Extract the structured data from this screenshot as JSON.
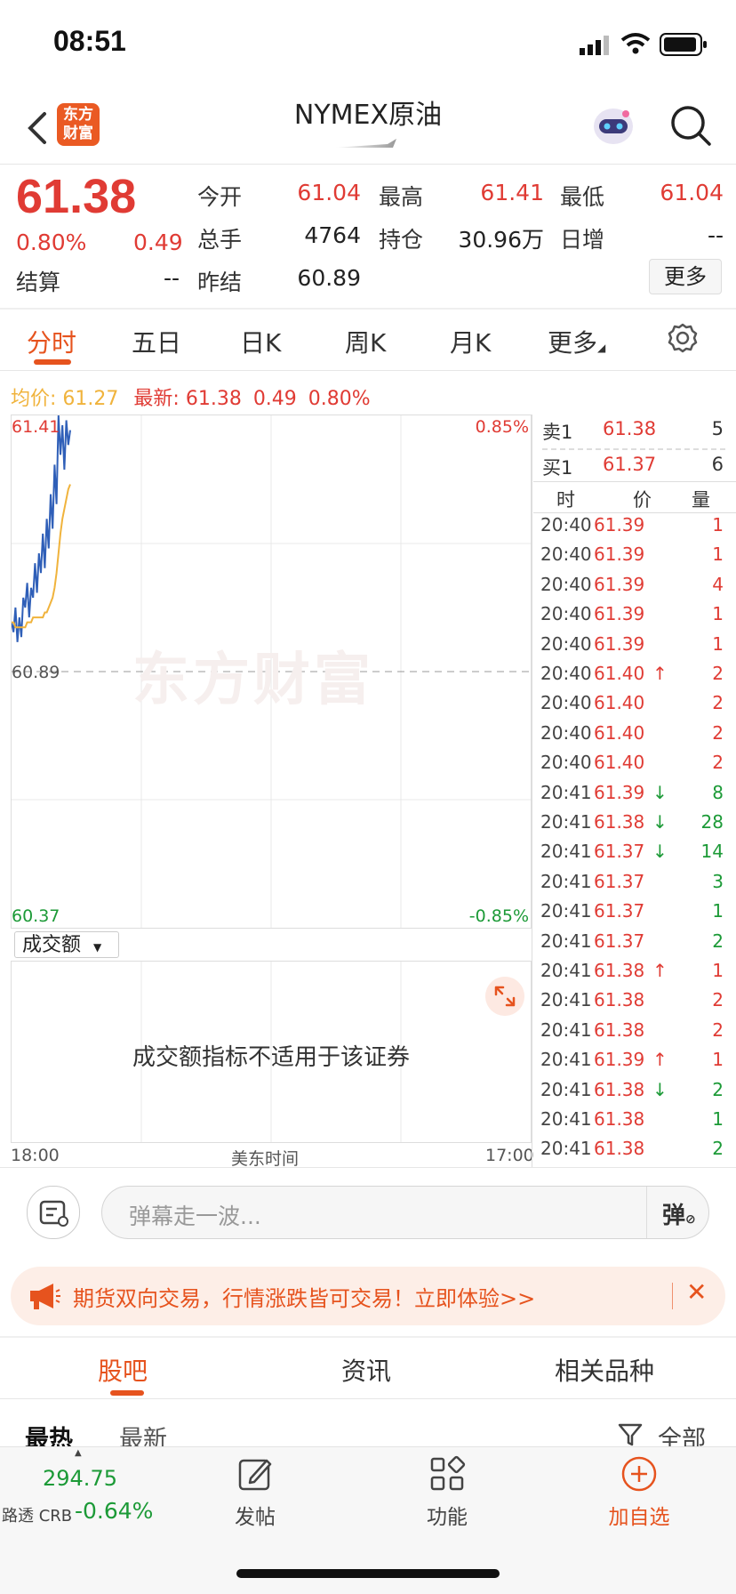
{
  "status_bar": {
    "time": "08:51"
  },
  "header": {
    "logo_line1": "东方",
    "logo_line2": "财富",
    "title": "NYMEX原油"
  },
  "quote": {
    "price": "61.38",
    "change_pct": "0.80%",
    "change": "0.49",
    "settle_label": "结算",
    "settle_value": "--",
    "fields": [
      {
        "label": "今开",
        "value": "61.04"
      },
      {
        "label": "最高",
        "value": "61.41"
      },
      {
        "label": "最低",
        "value": "61.04"
      },
      {
        "label": "总手",
        "value": "4764"
      },
      {
        "label": "持仓",
        "value": "30.96万"
      },
      {
        "label": "日增",
        "value": "--"
      },
      {
        "label": "昨结",
        "value": "60.89"
      }
    ],
    "more_label": "更多"
  },
  "chart_tabs": [
    "分时",
    "五日",
    "日K",
    "周K",
    "月K",
    "更多"
  ],
  "intraday": {
    "avg_label": "均价:",
    "avg_value": "61.27",
    "latest_label": "最新:",
    "latest_value": "61.38",
    "latest_change": "0.49",
    "latest_pct": "0.80%",
    "watermark": "东方财富",
    "cje_label": "成交额",
    "no_data": "成交额指标不适用于该证券",
    "x_left": "18:00",
    "x_mid": "美东时间",
    "x_right": "17:00"
  },
  "chart_data": {
    "type": "line",
    "title": "",
    "y_left_top": "61.41",
    "y_left_mid": "60.89",
    "y_left_bottom": "60.37",
    "y_right_top": "0.85%",
    "y_right_bottom": "-0.85%",
    "ylim": [
      60.37,
      61.41
    ],
    "reference": 60.89,
    "series": [
      {
        "values": [
          60.99,
          60.97,
          61.02,
          60.95,
          61.0,
          60.96,
          61.04,
          61.02,
          61.07,
          61.0,
          61.06,
          61.04,
          61.11,
          61.05,
          61.13,
          61.09,
          61.17,
          61.1,
          61.2,
          61.14,
          61.25,
          61.18,
          61.31,
          61.23,
          61.41,
          61.33,
          61.39,
          61.3,
          61.4,
          61.35,
          61.38
        ]
      },
      {
        "values": [
          60.99,
          60.99,
          60.98,
          60.98,
          60.98,
          60.98,
          60.98,
          60.98,
          60.99,
          60.99,
          60.99,
          61.0,
          61.0,
          61.0,
          61.0,
          61.0,
          61.0,
          61.01,
          61.01,
          61.02,
          61.03,
          61.04,
          61.06,
          61.09,
          61.13,
          61.17,
          61.2,
          61.22,
          61.24,
          61.26,
          61.27
        ]
      }
    ]
  },
  "order_book": {
    "ask_label": "卖1",
    "ask_price": "61.38",
    "ask_vol": "5",
    "bid_label": "买1",
    "bid_price": "61.37",
    "bid_vol": "6",
    "col_time": "时",
    "col_price": "价",
    "col_vol": "量",
    "trades": [
      {
        "time": "20:40",
        "price": "61.39",
        "arrow": "",
        "vol": "1",
        "dir": "up"
      },
      {
        "time": "20:40",
        "price": "61.39",
        "arrow": "",
        "vol": "1",
        "dir": "up"
      },
      {
        "time": "20:40",
        "price": "61.39",
        "arrow": "",
        "vol": "4",
        "dir": "up"
      },
      {
        "time": "20:40",
        "price": "61.39",
        "arrow": "",
        "vol": "1",
        "dir": "up"
      },
      {
        "time": "20:40",
        "price": "61.39",
        "arrow": "",
        "vol": "1",
        "dir": "up"
      },
      {
        "time": "20:40",
        "price": "61.40",
        "arrow": "↑",
        "vol": "2",
        "dir": "up"
      },
      {
        "time": "20:40",
        "price": "61.40",
        "arrow": "",
        "vol": "2",
        "dir": "up"
      },
      {
        "time": "20:40",
        "price": "61.40",
        "arrow": "",
        "vol": "2",
        "dir": "up"
      },
      {
        "time": "20:40",
        "price": "61.40",
        "arrow": "",
        "vol": "2",
        "dir": "up"
      },
      {
        "time": "20:41",
        "price": "61.39",
        "arrow": "↓",
        "vol": "8",
        "dir": "down"
      },
      {
        "time": "20:41",
        "price": "61.38",
        "arrow": "↓",
        "vol": "28",
        "dir": "down"
      },
      {
        "time": "20:41",
        "price": "61.37",
        "arrow": "↓",
        "vol": "14",
        "dir": "down"
      },
      {
        "time": "20:41",
        "price": "61.37",
        "arrow": "",
        "vol": "3",
        "dir": "down"
      },
      {
        "time": "20:41",
        "price": "61.37",
        "arrow": "",
        "vol": "1",
        "dir": "down"
      },
      {
        "time": "20:41",
        "price": "61.37",
        "arrow": "",
        "vol": "2",
        "dir": "down"
      },
      {
        "time": "20:41",
        "price": "61.38",
        "arrow": "↑",
        "vol": "1",
        "dir": "up"
      },
      {
        "time": "20:41",
        "price": "61.38",
        "arrow": "",
        "vol": "2",
        "dir": "up"
      },
      {
        "time": "20:41",
        "price": "61.38",
        "arrow": "",
        "vol": "2",
        "dir": "up"
      },
      {
        "time": "20:41",
        "price": "61.39",
        "arrow": "↑",
        "vol": "1",
        "dir": "up"
      },
      {
        "time": "20:41",
        "price": "61.38",
        "arrow": "↓",
        "vol": "2",
        "dir": "down"
      },
      {
        "time": "20:41",
        "price": "61.38",
        "arrow": "",
        "vol": "1",
        "dir": "down"
      },
      {
        "time": "20:41",
        "price": "61.38",
        "arrow": "",
        "vol": "2",
        "dir": "down"
      }
    ]
  },
  "comment": {
    "placeholder": "弹幕走一波...",
    "danmu_label": "弹"
  },
  "banner": {
    "text": "期货双向交易，行情涨跌皆可交易！立即体验>>",
    "close": "✕"
  },
  "bottom_tabs": [
    "股吧",
    "资讯",
    "相关品种"
  ],
  "sub_tabs": {
    "hot": "最热",
    "latest": "最新",
    "filter": "全部"
  },
  "bottom_nav": {
    "crb_value": "294.75",
    "crb_label": "路透 CRB",
    "crb_change": "-0.64%",
    "post": "发帖",
    "func": "功能",
    "add": "加自选"
  },
  "colors": {
    "up": "#e03b34",
    "down": "#1c9a37",
    "accent": "#e6531e",
    "price_line": "#2f5fb8",
    "avg_line": "#f0b33c"
  }
}
